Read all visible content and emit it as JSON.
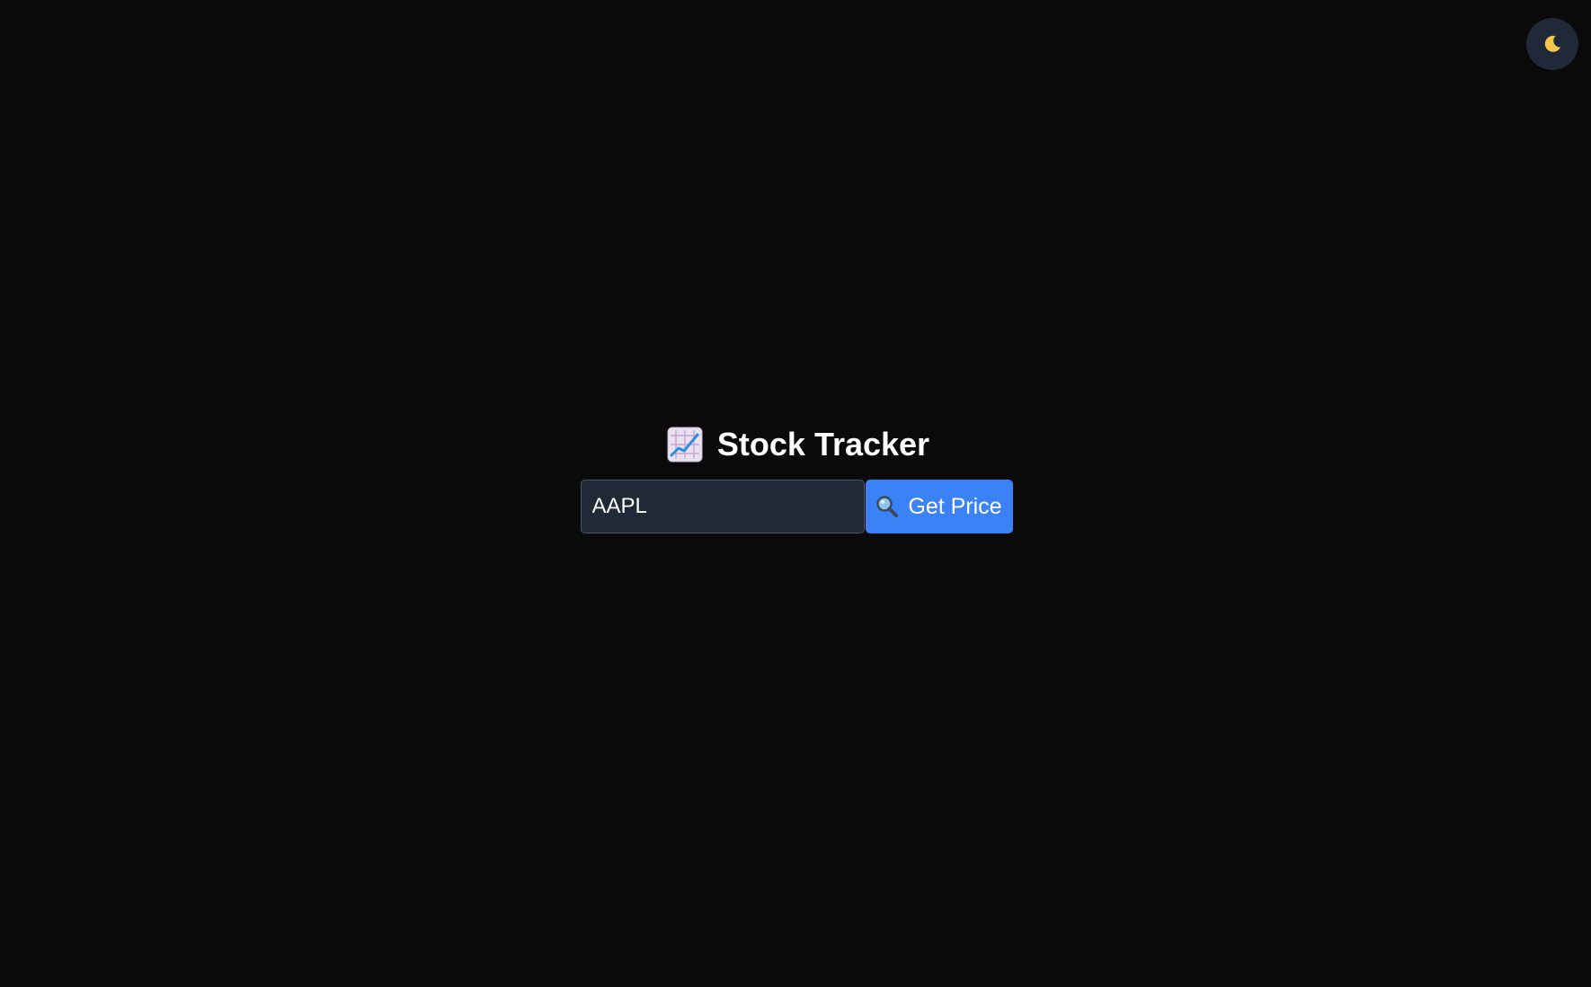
{
  "app": {
    "title": "Stock Tracker",
    "title_icon": "chart-increasing-icon"
  },
  "theme_toggle": {
    "icon": "moon-icon",
    "icon_color": "#f6c54b"
  },
  "search": {
    "value": "AAPL",
    "button_label": "Get Price",
    "button_icon": "magnifying-glass-icon"
  },
  "colors": {
    "background": "#0a0a0b",
    "accent": "#3b82f6",
    "input_background": "#1f2937"
  }
}
